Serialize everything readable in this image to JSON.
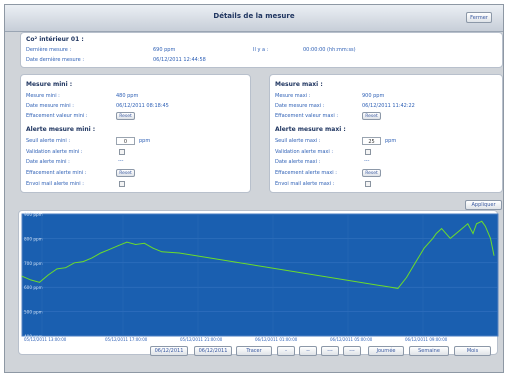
{
  "header": {
    "title": "Détails de la mesure",
    "close_label": "Fermer"
  },
  "info": {
    "title": "Co² intérieur 01 :",
    "last_measure_label": "Dernière mesure :",
    "last_measure_value": "690 ppm",
    "ago_label": "Il y a :",
    "ago_value": "00:00:00 (hh:mm:ss)",
    "date_label": "Date dernière mesure :",
    "date_value": "06/12/2011 12:44:58"
  },
  "min": {
    "title": "Mesure mini :",
    "measure_label": "Mesure mini :",
    "measure_value": "480 ppm",
    "date_label": "Date mesure mini :",
    "date_value": "06/12/2011 08:18:45",
    "reset_label": "Effacement valeur mini :",
    "reset_button": "Reset",
    "alert_title": "Alerte mesure mini :",
    "threshold_label": "Seuil alerte mini :",
    "threshold_value": "0",
    "threshold_unit": "ppm",
    "validation_label": "Validation alerte mini :",
    "alert_date_label": "Date alerte mini :",
    "alert_date_value": "---",
    "alert_reset_label": "Effacement alerte mini :",
    "alert_reset_button": "Reset",
    "mail_label": "Envoi mail alerte mini :"
  },
  "max": {
    "title": "Mesure maxi :",
    "measure_label": "Mesure maxi :",
    "measure_value": "900 ppm",
    "date_label": "Date mesure maxi :",
    "date_value": "06/12/2011 11:42:22",
    "reset_label": "Effacement valeur maxi :",
    "reset_button": "Reset",
    "alert_title": "Alerte mesure maxi :",
    "threshold_label": "Seuil alerte maxi :",
    "threshold_value": "25",
    "threshold_unit": "ppm",
    "validation_label": "Validation alerte maxi :",
    "alert_date_label": "Date alerte maxi :",
    "alert_date_value": "---",
    "alert_reset_label": "Effacement alerte maxi :",
    "alert_reset_button": "Reset",
    "mail_label": "Envoi mail alerte maxi :"
  },
  "apply_label": "Appliquer",
  "nav": {
    "date_from": "06/12/2011",
    "date_to": "06/12/2011",
    "trace": "Tracer",
    "btn_a": "-",
    "btn_b": "--",
    "btn_c": "---",
    "btn_d": "---",
    "day": "Journée",
    "week": "Semaine",
    "month": "Mois"
  },
  "colors": {
    "chart_bg": "#1a5fb0",
    "line": "#6cdd2a",
    "frame": "#d0d4d9",
    "label": "#2d5fb5"
  },
  "chart_data": {
    "type": "line",
    "title": "",
    "xlabel": "",
    "ylabel": "",
    "ylim": [
      400,
      900
    ],
    "yticks": [
      "400 ppm",
      "500 ppm",
      "600 ppm",
      "700 ppm",
      "800 ppm",
      "900 ppm"
    ],
    "xticks": [
      "05/12/2011 13:00:00",
      "05/12/2011 17:00:00",
      "05/12/2011 21:00:00",
      "06/12/2011 01:00:00",
      "06/12/2011 05:00:00",
      "06/12/2011 09:00:00"
    ],
    "xrange": [
      0,
      24
    ],
    "series": [
      {
        "name": "",
        "x": [
          0,
          0.5,
          1,
          1.5,
          2,
          2.5,
          3,
          3.5,
          4,
          4.5,
          5,
          5.5,
          6,
          6.5,
          7,
          7.5,
          8,
          9,
          21.5,
          22,
          22.5,
          23,
          23.5,
          23.7,
          24,
          24.5,
          25,
          25.5,
          25.8,
          26,
          26.3,
          26.5,
          26.8,
          27
        ],
        "y": [
          645,
          630,
          620,
          650,
          675,
          680,
          700,
          705,
          720,
          740,
          755,
          770,
          785,
          775,
          780,
          760,
          745,
          740,
          595,
          640,
          700,
          760,
          800,
          820,
          840,
          800,
          830,
          860,
          820,
          860,
          870,
          850,
          800,
          730
        ]
      }
    ]
  }
}
